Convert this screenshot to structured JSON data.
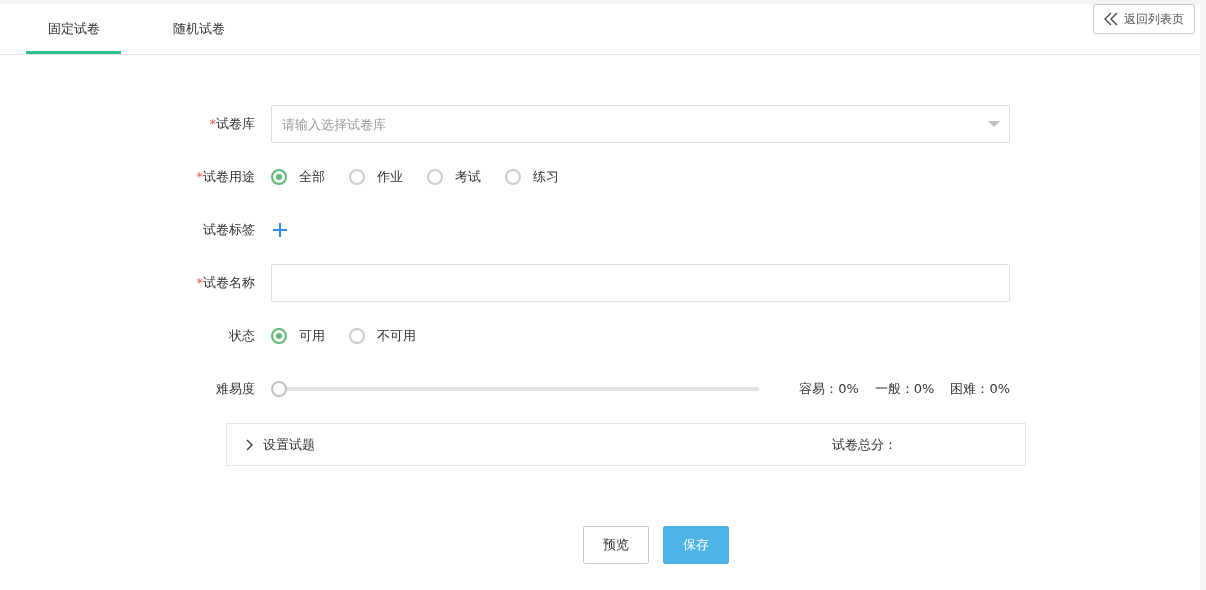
{
  "tabs": [
    {
      "label": "固定试卷",
      "selected": true
    },
    {
      "label": "随机试卷",
      "selected": false
    }
  ],
  "back_button": {
    "label": "返回列表页"
  },
  "form": [
    {
      "kind": "select",
      "label": "试卷库",
      "required_mark": "*",
      "placeholder": "请输入选择试卷库"
    },
    {
      "kind": "radio",
      "label": "试卷用途",
      "required_mark": "*",
      "options": [
        {
          "label": "全部",
          "selected": true
        },
        {
          "label": "作业",
          "selected": false
        },
        {
          "label": "考试",
          "selected": false
        },
        {
          "label": "练习",
          "selected": false
        }
      ]
    },
    {
      "kind": "tags",
      "label": "试卷标签"
    },
    {
      "kind": "input",
      "label": "试卷名称",
      "required_mark": "*"
    },
    {
      "kind": "radio",
      "label": "状态",
      "options": [
        {
          "label": "可用",
          "selected": true
        },
        {
          "label": "不可用",
          "selected": false
        }
      ]
    },
    {
      "kind": "slider",
      "label": "难易度",
      "level": 0,
      "readings": [
        "容易：0%",
        "一般：0%",
        "困难：0%"
      ]
    }
  ],
  "section": {
    "title": "设置试题",
    "expanded": false,
    "total_label": "试卷总分："
  },
  "buttons": [
    {
      "label": "预览",
      "primary": false
    },
    {
      "label": "保存",
      "primary": true
    }
  ]
}
